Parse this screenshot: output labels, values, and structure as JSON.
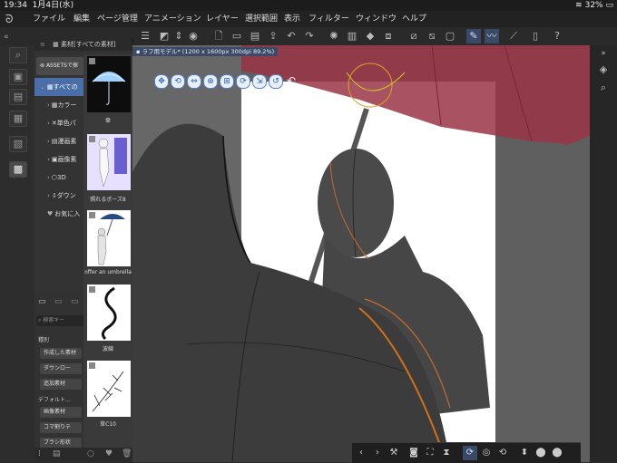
{
  "status": {
    "time": "19:34",
    "date": "1月4日(水)",
    "battery": "32%"
  },
  "menu": {
    "items": [
      "ファイル",
      "編集",
      "ページ管理",
      "アニメーション",
      "レイヤー",
      "選択範囲",
      "表示",
      "フィルター",
      "ウィンドウ",
      "ヘルプ"
    ]
  },
  "panel": {
    "header": "素材[すべての素材]",
    "assets_label": "ASSETSで探",
    "tree": [
      {
        "label": "すべての"
      },
      {
        "label": "カラー"
      },
      {
        "label": "単色パ"
      },
      {
        "label": "漫画素"
      },
      {
        "label": "画像素"
      },
      {
        "label": "3D"
      },
      {
        "label": "ダウン"
      },
      {
        "label": "お気に入"
      }
    ],
    "thumbnails": [
      {
        "caption": "傘"
      },
      {
        "caption": "照れるポーズ8"
      },
      {
        "caption": "offer an umbrella"
      },
      {
        "caption": "波線"
      },
      {
        "caption": "草C10"
      }
    ],
    "search_placeholder": "検索キー",
    "type_header": "種別",
    "type_buttons": [
      "作成した素材",
      "ダウンロー",
      "追加素材"
    ],
    "default_header": "デフォルト...",
    "default_buttons": [
      "画像素材",
      "コマ割りテ",
      "ブラシ形状"
    ]
  },
  "canvas": {
    "tab_label": "ラフ用モデル* (1200 x 1600px 300dpi 89.2%)"
  },
  "colors": {
    "accent": "#4a6ea8",
    "umbrella": "#9a3546",
    "canvas_bg": "#5f5f5f"
  }
}
